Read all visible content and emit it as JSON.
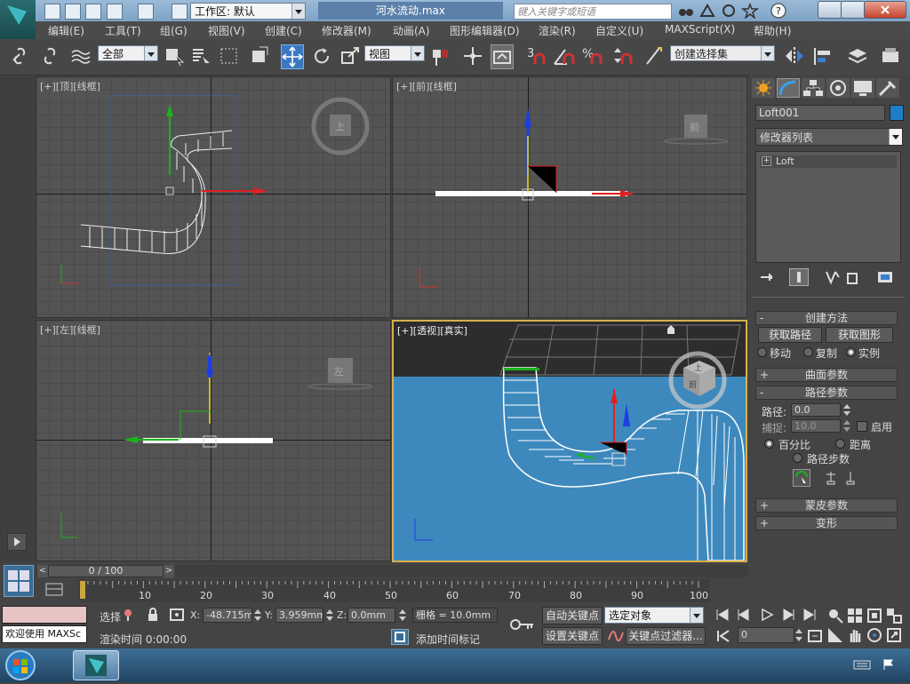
{
  "window": {
    "workspace_label": "工作区: 默认",
    "file_title": "河水流动.max",
    "search_placeholder": "键入关键字或短语"
  },
  "menubar": [
    "编辑(E)",
    "工具(T)",
    "组(G)",
    "视图(V)",
    "创建(C)",
    "修改器(M)",
    "动画(A)",
    "图形编辑器(D)",
    "渲染(R)",
    "自定义(U)",
    "MAXScript(X)",
    "帮助(H)"
  ],
  "toolbar": {
    "selection_filter": "全部",
    "reference_coord": "视图",
    "named_selection_placeholder": "创建选择集",
    "snap_label": "3",
    "percent_label": "%"
  },
  "viewports": {
    "top": "[+][顶][线框]",
    "front": "[+][前][线框]",
    "left": "[+][左][线框]",
    "perspective": "[+][透视][真实]",
    "cube_top": "上",
    "cube_front": "前",
    "cube_left": "左",
    "cube_persp_a": "上",
    "cube_persp_b": "前"
  },
  "command_panel": {
    "object_name": "Loft001",
    "object_color": "#1e7fc8",
    "modifier_list": "修改器列表",
    "stack_item": "Loft",
    "rollouts": {
      "creation_method": "创建方法",
      "get_path": "获取路径",
      "get_shape": "获取图形",
      "move": "移动",
      "copy": "复制",
      "instance": "实例",
      "surface_params": "曲面参数",
      "path_params": "路径参数",
      "path_label": "路径:",
      "path_value": "0.0",
      "snap_label": "捕捉:",
      "snap_value": "10.0",
      "enable": "启用",
      "percentage": "百分比",
      "distance": "距离",
      "path_steps": "路径步数",
      "skin_params": "蒙皮参数",
      "deformation": "变形"
    }
  },
  "timeline": {
    "frame_counter": "0 / 100",
    "ticks": [
      "10",
      "20",
      "30",
      "40",
      "50",
      "60",
      "70",
      "80",
      "90",
      "100"
    ]
  },
  "status": {
    "welcome": "欢迎使用 MAXSc",
    "select_label": "选择",
    "x_label": "X:",
    "x_value": "-48.715mm",
    "y_label": "Y:",
    "y_value": "3.959mm",
    "z_label": "Z:",
    "z_value": "0.0mm",
    "grid": "栅格 = 10.0mm",
    "render_time": "渲染时间  0:00:00",
    "add_time_tag": "添加时间标记",
    "auto_key": "自动关键点",
    "selected_object": "选定对象",
    "set_key": "设置关键点",
    "key_filter": "关键点过滤器...",
    "frame_value": "0"
  },
  "colors": {
    "water": "#3d89bd",
    "accent": "#2d7fd0"
  }
}
